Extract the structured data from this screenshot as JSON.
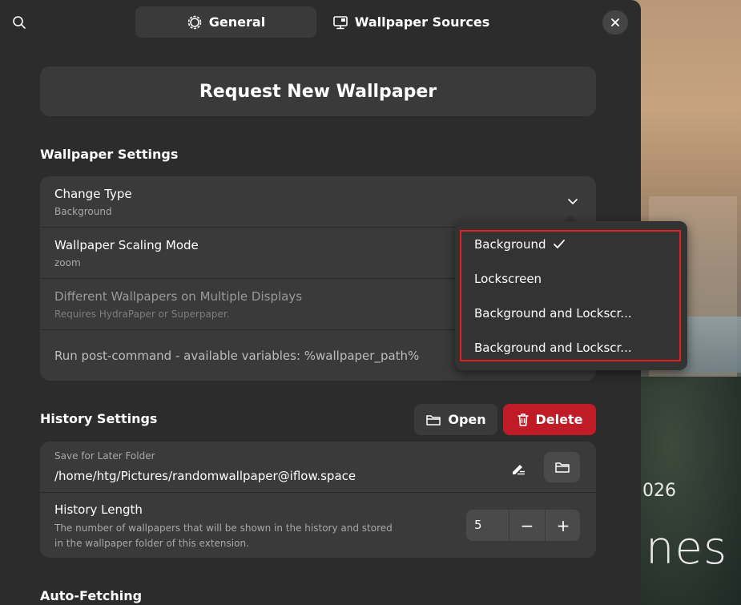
{
  "header": {
    "tabs": [
      {
        "label": "General",
        "icon": "gear-icon",
        "active": true
      },
      {
        "label": "Wallpaper Sources",
        "icon": "monitor-icon",
        "active": false
      }
    ]
  },
  "actions": {
    "request_label": "Request New Wallpaper"
  },
  "wallpaper_settings": {
    "title": "Wallpaper Settings",
    "rows": [
      {
        "title": "Change Type",
        "subtitle": "Background"
      },
      {
        "title": "Wallpaper Scaling Mode",
        "subtitle": "zoom"
      },
      {
        "title": "Different Wallpapers on Multiple Displays",
        "subtitle": "Requires HydraPaper or Superpaper."
      },
      {
        "title": "Run post-command - available variables: %wallpaper_path%"
      }
    ]
  },
  "change_type_menu": {
    "items": [
      {
        "label": "Background",
        "checked": true
      },
      {
        "label": "Lockscreen"
      },
      {
        "label": "Background and Lockscr..."
      },
      {
        "label": "Background and Lockscr..."
      }
    ]
  },
  "history_settings": {
    "title": "History Settings",
    "open_label": "Open",
    "delete_label": "Delete",
    "folder": {
      "label": "Save for Later Folder",
      "path": "/home/htg/Pictures/randomwallpaper@iflow.space"
    },
    "length": {
      "title": "History Length",
      "description_line1": "The number of wallpapers that will be shown in the history and stored",
      "description_line2": "in the wallpaper folder of this extension.",
      "value": "5",
      "minus": "−",
      "plus": "+"
    }
  },
  "auto_fetching": {
    "title": "Auto-Fetching"
  },
  "background_text": {
    "year": "026",
    "word": "nes"
  },
  "colors": {
    "window_bg": "#2c2c2c",
    "card_bg": "#3a3a3a",
    "delete_red": "#c01c28",
    "highlight_red": "#e0201c"
  }
}
